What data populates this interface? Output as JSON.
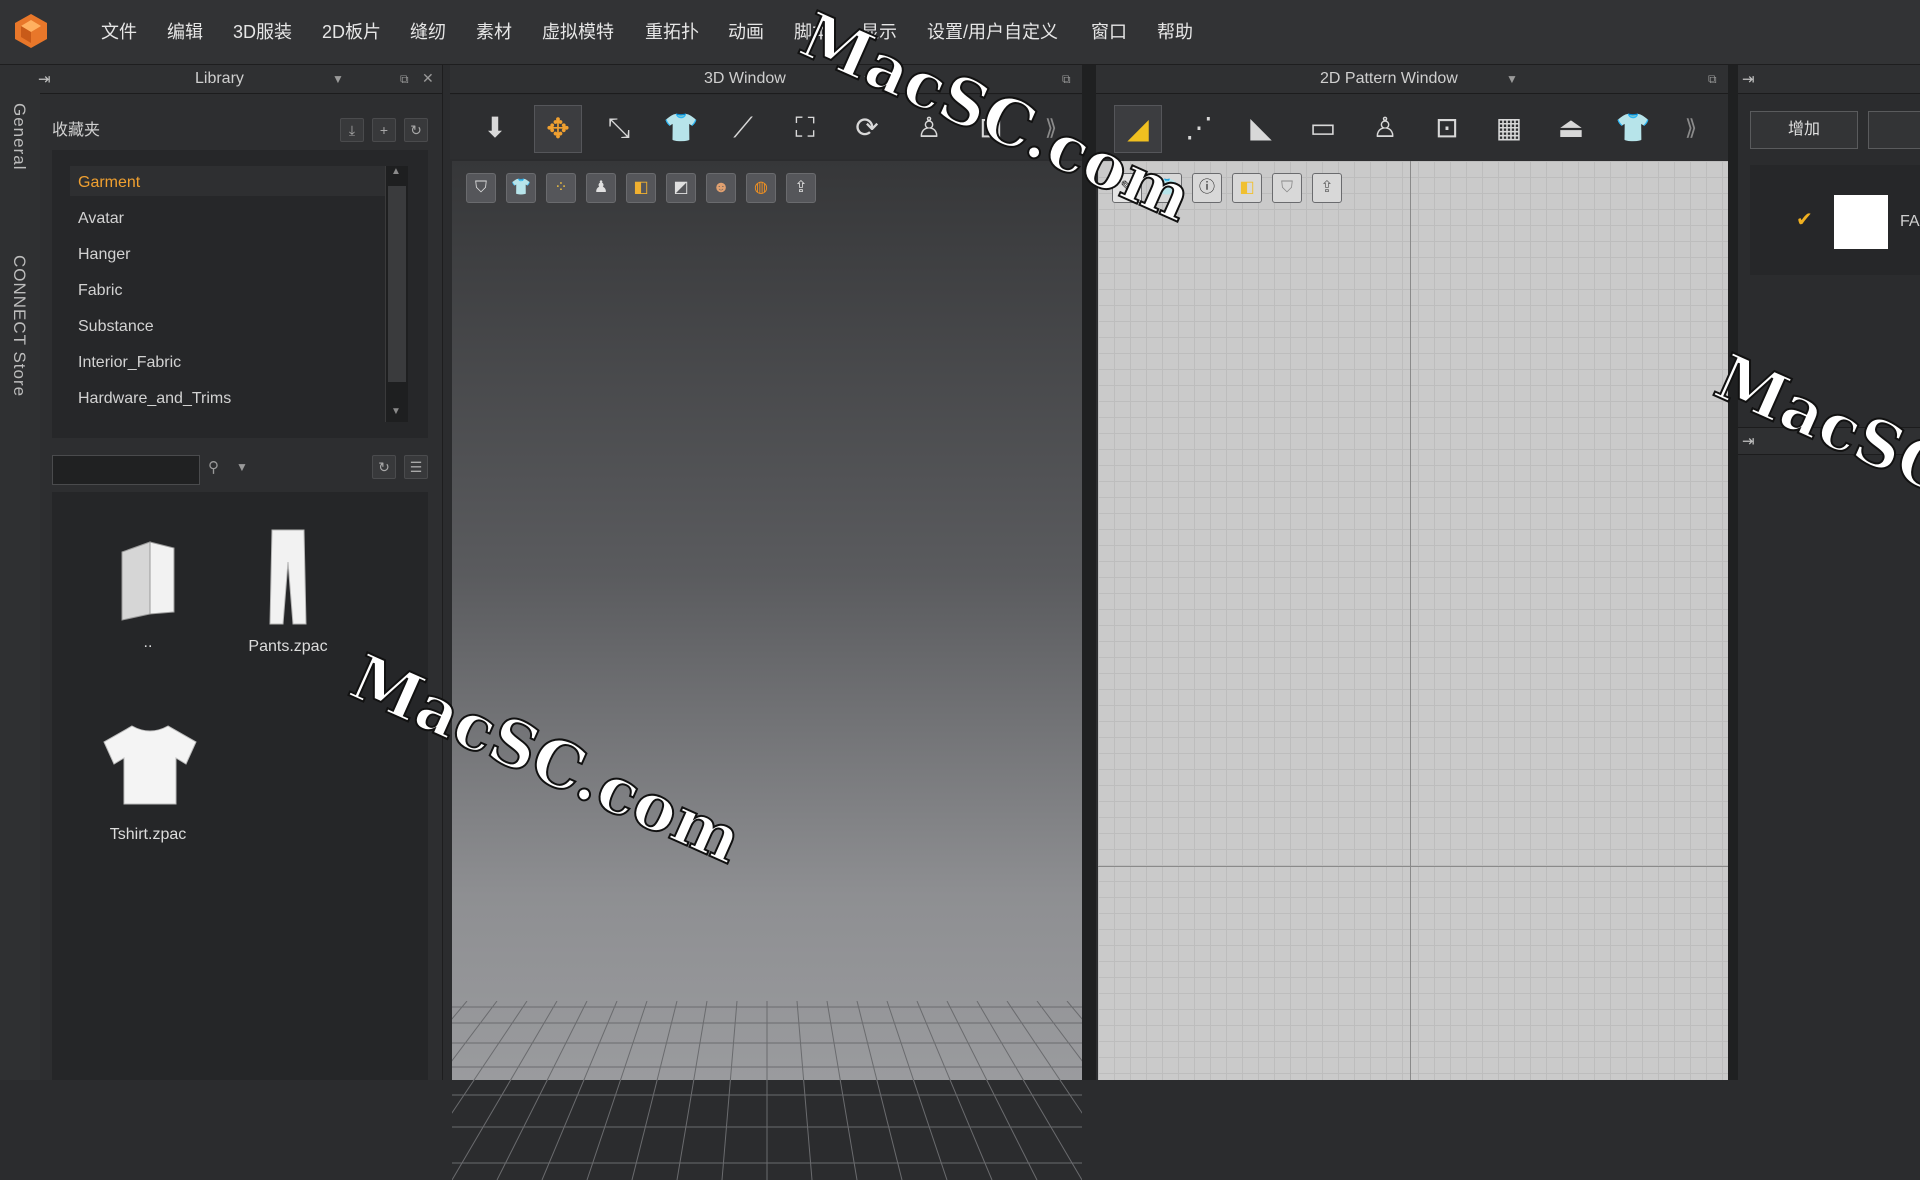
{
  "menu": [
    "文件",
    "编辑",
    "3D服装",
    "2D板片",
    "缝纫",
    "素材",
    "虚拟模特",
    "重拓扑",
    "动画",
    "脚本",
    "显示",
    "设置/用户自定义",
    "窗口",
    "帮助"
  ],
  "left_tabs": [
    "General",
    "CONNECT Store"
  ],
  "library": {
    "title": "Library",
    "favorites_title": "收藏夹",
    "tree_items": [
      "Garment",
      "Avatar",
      "Hanger",
      "Fabric",
      "Substance",
      "Interior_Fabric",
      "Hardware_and_Trims"
    ],
    "selected_item": "Garment",
    "search_placeholder": "",
    "files": [
      {
        "name": "..",
        "icon": "folder-icon"
      },
      {
        "name": "Pants.zpac",
        "icon": "pants-icon"
      },
      {
        "name": "Tshirt.zpac",
        "icon": "tshirt-icon"
      }
    ]
  },
  "window3d": {
    "title": "3D Window",
    "toolbar": [
      "arrow-down-icon",
      "move-icon",
      "select-mesh-icon",
      "garment-icon",
      "pin-icon",
      "fold-icon",
      "transform-icon",
      "avatar-icon",
      "measure-icon"
    ],
    "subtools": [
      "garment-view-icon",
      "tshirt-view-icon",
      "dots-icon",
      "avatar-view-icon",
      "fabric-view-icon",
      "texture-icon",
      "skin-icon",
      "globe-icon",
      "export-icon"
    ]
  },
  "window2d": {
    "title": "2D Pattern Window",
    "toolbar": [
      "pattern-edit-icon",
      "edit-points-icon",
      "polygon-icon",
      "rectangle-icon",
      "avatar-pose-icon",
      "transform-icon",
      "grid-icon",
      "iron-icon",
      "tshirt-icon"
    ],
    "subtools": [
      "pen-eye-icon",
      "tshirt-eye-icon",
      "info-icon",
      "sticker-icon",
      "shirt-lock-icon",
      "export-icon"
    ]
  },
  "right_panel": {
    "add_label": "增加",
    "fabric_name": "FA"
  },
  "watermarks": [
    "MacSC.com",
    "MacSC.com",
    "MacSC.com"
  ],
  "colors": {
    "accent": "#f0a030",
    "check": "#f0b020"
  }
}
